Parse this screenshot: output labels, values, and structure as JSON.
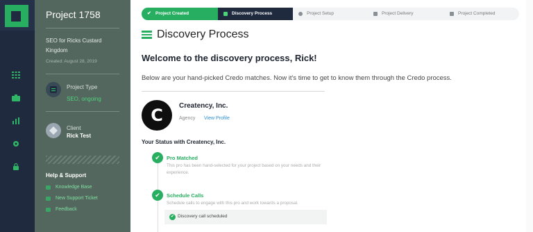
{
  "project": {
    "title": "Project 1758",
    "name": "SEO for Ricks Custard Kingdom",
    "created": "Created: August 28, 2019",
    "type_label": "Project Type",
    "type_value": "SEO, ongoing",
    "client_label": "Client",
    "client_value": "Rick Test"
  },
  "help": {
    "title": "Help & Support",
    "items": [
      "Knowledge Base",
      "New Support Ticket",
      "Feedback"
    ]
  },
  "steps": [
    "Project Created",
    "Discovery Process",
    "Project Setup",
    "Project Delivery",
    "Project Completed"
  ],
  "main": {
    "title": "Discovery Process",
    "welcome": "Welcome to the discovery process, Rick!",
    "intro": "Below are your hand-picked Credo matches. Now it's time to get to know them through the Credo process."
  },
  "match": {
    "avatar_letter": "C",
    "company": "Creatency, Inc.",
    "kind": "Agency",
    "view_profile": "View Profile"
  },
  "status": {
    "title": "Your Status with Creatency, Inc.",
    "items": [
      {
        "title": "Pro Matched",
        "desc": "This pro has been hand-selected for your project based on your needs and their experience."
      },
      {
        "title": "Schedule Calls",
        "desc": "Schedule calls to engage with this pro and work towards a proposal."
      }
    ],
    "scheduled": "Discovery call scheduled"
  },
  "icons": {
    "logo": "credo-logo-icon",
    "rail": [
      "grid-icon",
      "briefcase-icon",
      "chart-icon",
      "gear-icon",
      "lock-icon"
    ]
  },
  "colors": {
    "accent": "#27ae60",
    "navy": "#1f2a3f",
    "sidebar": "#54675f",
    "link": "#2b8fd6"
  }
}
